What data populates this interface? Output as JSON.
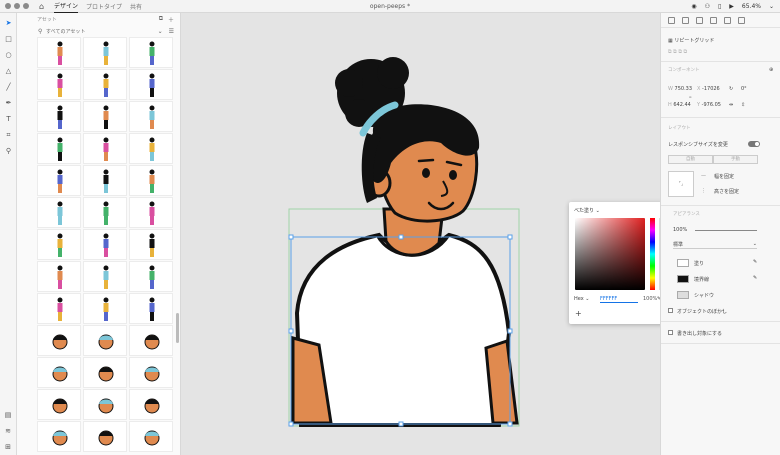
{
  "app": {
    "tabs": [
      "デザイン",
      "プロトタイプ",
      "共有"
    ],
    "active_tab": "デザイン",
    "doc_title": "open-peeps *",
    "zoom": "65.4%"
  },
  "assets": {
    "header": "アセット",
    "search_placeholder": "すべてのアセット"
  },
  "properties": {
    "repeat_grid": "リピートグリッド",
    "component_label": "コンポーネント",
    "w": "750.33",
    "h": "642.44",
    "x": "-17026",
    "y": "-976.05",
    "rotation": "0°",
    "layout_label": "レイアウト",
    "responsive_resize": "レスポンシブサイズを変更",
    "auto_btn": "自動",
    "manual_btn": "手動",
    "pin_h": "幅を固定",
    "pin_v": "高さを固定",
    "appearance_label": "アピアランス",
    "opacity": "100%",
    "blend": "標準",
    "fill": "塗り",
    "border": "境界線",
    "shadow": "シャドウ",
    "object_blur": "オブジェクトのぼかし",
    "include_on_export": "書き出し対象にする"
  },
  "picker": {
    "mode_header": "べた塗り",
    "color_mode": "Hex",
    "hex": "FFFFFF",
    "opacity": "100%",
    "add_label": "+"
  },
  "colors": {
    "accent": "#1473e6",
    "skin": "#e08a4f",
    "hair": "#111111",
    "headband": "#7cc6d8",
    "shirt": "#ffffff",
    "canvas_bg": "#e4e4e4"
  }
}
